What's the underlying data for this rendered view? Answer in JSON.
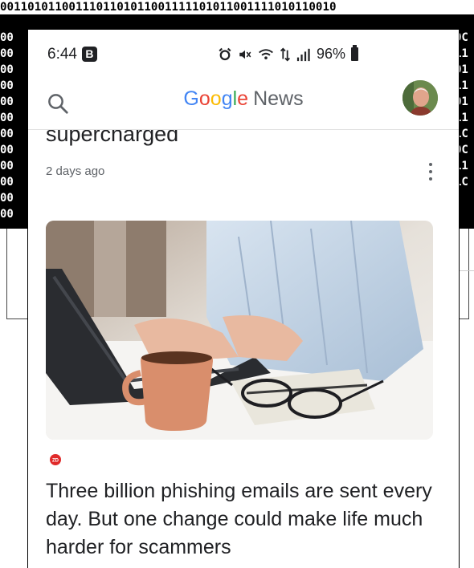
{
  "background": {
    "binary_top_row": "0011010110011101101011001111101011001111010110010",
    "left_column": [
      "00",
      "00",
      "00",
      "00",
      "00",
      "00",
      "00",
      "00",
      "00",
      "00",
      "00",
      "00"
    ],
    "right_column": [
      "0C",
      "11",
      "01",
      "11",
      "01",
      "11",
      "1C",
      "0C",
      "11",
      "1C"
    ]
  },
  "status_bar": {
    "time": "6:44",
    "badge": "B",
    "icons": [
      "alarm-icon",
      "mute-icon",
      "wifi-icon",
      "data-icon",
      "signal-icon"
    ],
    "battery_percent": "96%"
  },
  "app_bar": {
    "brand_letters": [
      "G",
      "o",
      "o",
      "g",
      "l",
      "e"
    ],
    "brand_suffix": "News",
    "search_icon": "search-icon"
  },
  "feed": {
    "previous_headline_tail": "supercharged",
    "previous_timestamp": "2 days ago",
    "article": {
      "source_icon": "zdnet-logo",
      "title": "Three billion phishing emails are sent every day. But one change could make life much harder for scammers"
    }
  },
  "colors": {
    "google_blue": "#4285f4",
    "google_red": "#ea4335",
    "google_yellow": "#fbbc05",
    "google_green": "#34a853",
    "text_primary": "#202124",
    "text_secondary": "#5f6368"
  }
}
